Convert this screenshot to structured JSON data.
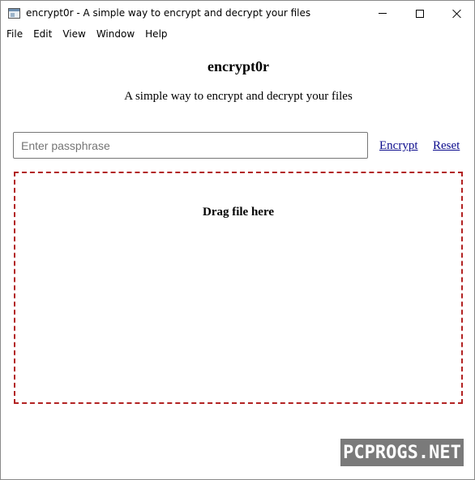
{
  "window": {
    "title": "encrypt0r - A simple way to encrypt and decrypt your files",
    "minimize_icon": "minimize-icon",
    "maximize_icon": "maximize-icon",
    "close_icon": "close-icon"
  },
  "menu": {
    "items": [
      {
        "label": "File"
      },
      {
        "label": "Edit"
      },
      {
        "label": "View"
      },
      {
        "label": "Window"
      },
      {
        "label": "Help"
      }
    ]
  },
  "main": {
    "title": "encrypt0r",
    "subtitle": "A simple way to encrypt and decrypt your files",
    "passphrase": {
      "value": "",
      "placeholder": "Enter passphrase"
    },
    "encrypt_label": "Encrypt",
    "reset_label": "Reset",
    "dropzone_label": "Drag file here"
  },
  "watermark": {
    "text": "PCPROGS.NET"
  },
  "colors": {
    "dropzone_border": "#b22222",
    "link": "#0b0b8c",
    "watermark_bg": "#7a7a7a"
  }
}
